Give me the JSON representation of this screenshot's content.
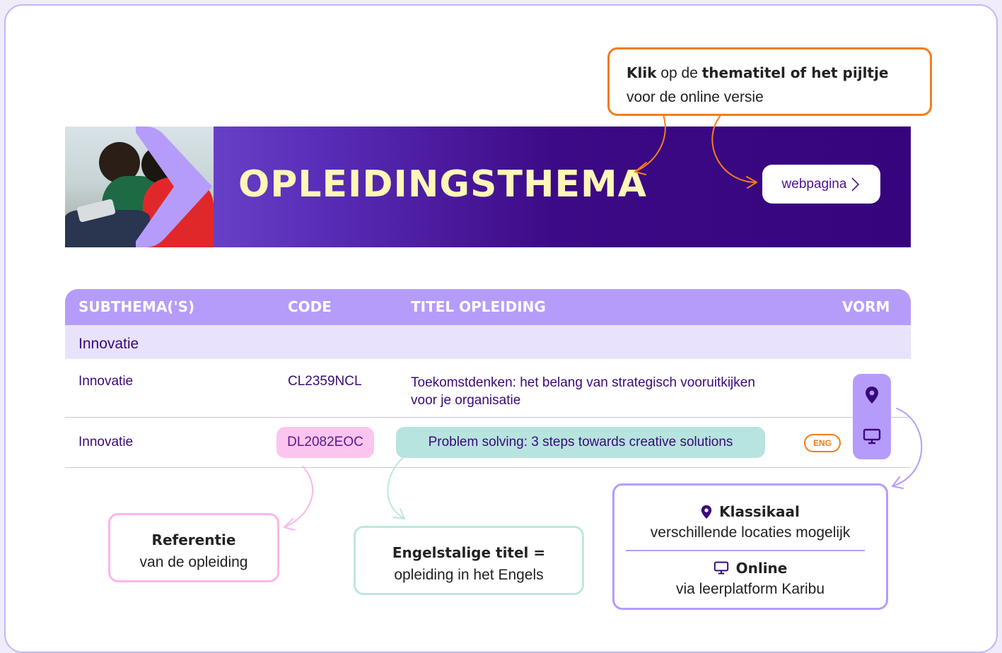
{
  "callout_top": {
    "klik": "Klik",
    "op_de": " op de ",
    "thematitel": "thematitel of het pijltje",
    "line2": "voor de online versie"
  },
  "banner": {
    "title": "OPLEIDINGSTHEMA",
    "button_label": "webpagina",
    "accent": "#fff6b8"
  },
  "table": {
    "headers": [
      "SUBTHEMA('S)",
      "CODE",
      "TITEL OPLEIDING",
      "VORM"
    ],
    "group": "Innovatie",
    "rows": [
      {
        "subthema": "Innovatie",
        "code": "CL2359NCL",
        "title_line1": "Toekomstdenken: het belang van strategisch vooruitkijken",
        "title_line2": "voor je organisatie"
      },
      {
        "subthema": "Innovatie",
        "code": "DL2082EOC",
        "title": "Problem solving: 3 steps towards creative solutions",
        "badge": "ENG"
      }
    ],
    "vorm_icons": [
      "location-pin-icon",
      "monitor-icon"
    ]
  },
  "callout_ref": {
    "title": "Referentie",
    "text": "van de opleiding"
  },
  "callout_eng": {
    "title": "Engelstalige titel =",
    "text": "opleiding in het Engels"
  },
  "callout_vorm": {
    "klassikaal_title": "Klassikaal",
    "klassikaal_text": "verschillende locaties mogelijk",
    "online_title": "Online",
    "online_text": "via leerplatform Karibu"
  },
  "colors": {
    "purple_dark": "#3c0a86",
    "purple_light": "#b59cfb",
    "orange": "#f47c1c",
    "pink": "#fbb6ea",
    "teal": "#bfe6e1"
  }
}
